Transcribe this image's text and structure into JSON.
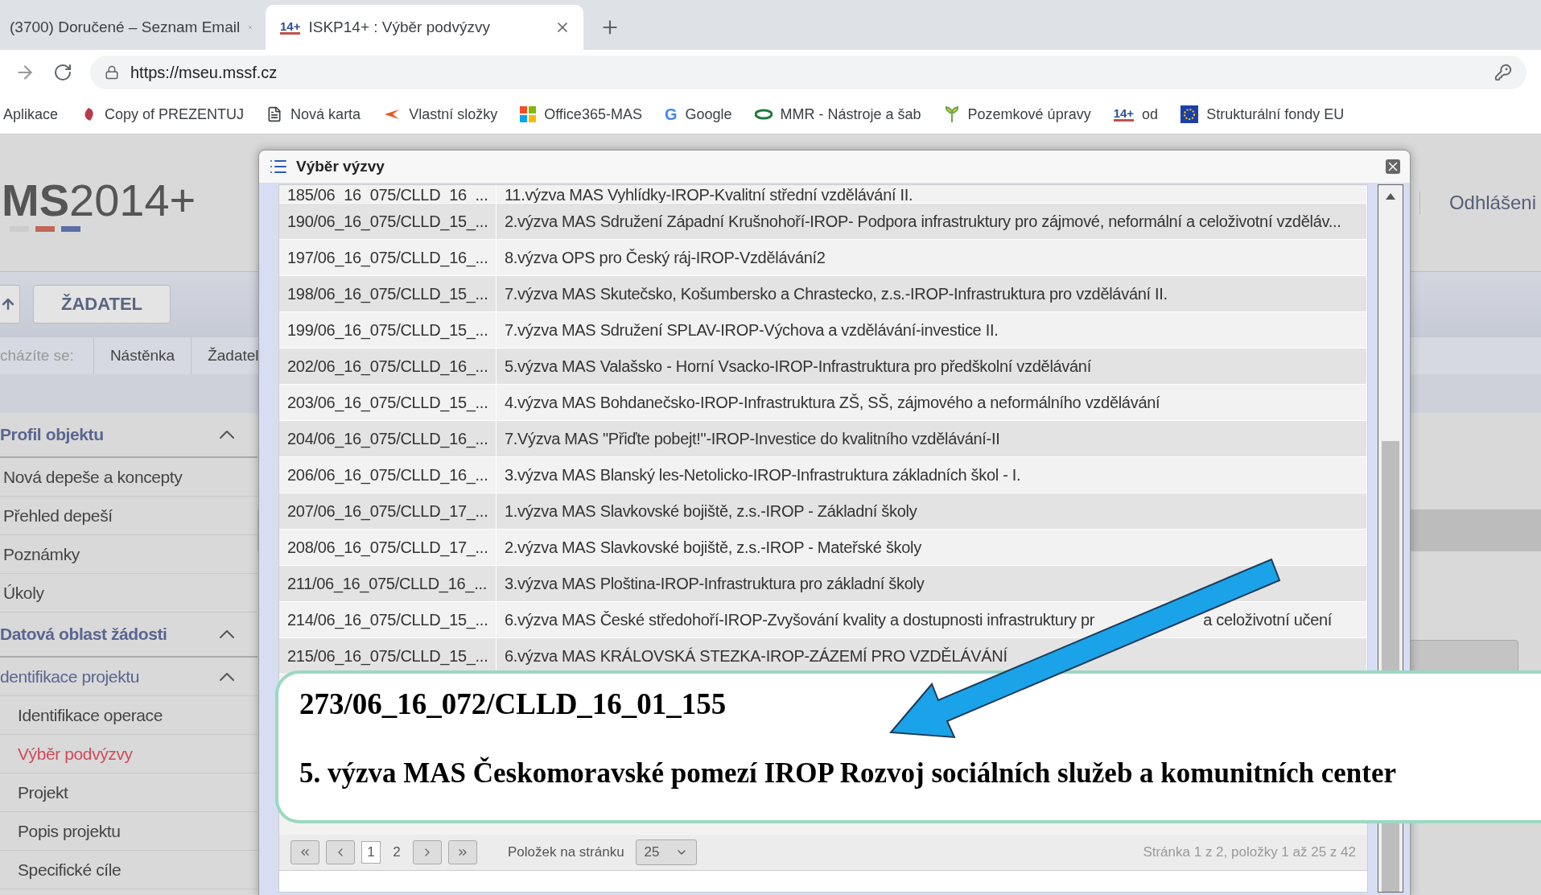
{
  "browser": {
    "tabs": [
      {
        "title": "(3700) Doručené – Seznam Email",
        "selected": false
      },
      {
        "title": "ISKP14+ : Výběr podvýzvy",
        "icon_text": "14+",
        "selected": true
      }
    ],
    "url": "https://mseu.mssf.cz",
    "bookmarks": [
      {
        "kind": "apps",
        "label": "Aplikace"
      },
      {
        "kind": "app",
        "label": "Copy of PREZENTUJ"
      },
      {
        "kind": "page",
        "label": "Nová karta"
      },
      {
        "kind": "folder",
        "label": "Vlastní složky"
      },
      {
        "kind": "windows",
        "label": "Office365-MAS"
      },
      {
        "kind": "google",
        "label": "Google",
        "icon_text": "G"
      },
      {
        "kind": "mmr",
        "label": "MMR - Nástroje a šab"
      },
      {
        "kind": "leaf",
        "label": "Pozemkové úpravy"
      },
      {
        "kind": "iskp",
        "label": "od",
        "icon_text": "14+"
      },
      {
        "kind": "eu",
        "label": "Strukturální fondy EU"
      }
    ]
  },
  "page": {
    "logo": {
      "bold": "MS",
      "light": "2014+"
    },
    "logout": "Odhlášeni",
    "role_button": "ŽADATEL",
    "breadcrumb": [
      "cházíte se:",
      "Nástěnka",
      "Žadatel"
    ],
    "sidebar": [
      {
        "kind": "section",
        "label": "Profil objektu",
        "expanded": true,
        "children": [
          {
            "kind": "item",
            "label": "Nová depeše a koncepty",
            "selected": false
          },
          {
            "kind": "item",
            "label": "Přehled depeší",
            "selected": false
          },
          {
            "kind": "item",
            "label": "Poznámky",
            "selected": false
          },
          {
            "kind": "item",
            "label": "Úkoly",
            "selected": false
          }
        ]
      },
      {
        "kind": "section",
        "label": "Datová oblast žádosti",
        "expanded": true,
        "children": [
          {
            "kind": "group",
            "label": "dentifikace projektu",
            "expanded": true,
            "children": [
              {
                "kind": "item",
                "label": "Identifikace operace",
                "selected": false
              },
              {
                "kind": "item",
                "label": "Výběr podvýzvy",
                "selected": true
              },
              {
                "kind": "item",
                "label": "Projekt",
                "selected": false
              },
              {
                "kind": "item",
                "label": "Popis projektu",
                "selected": false
              },
              {
                "kind": "item",
                "label": "Specifické cíle",
                "selected": false
              }
            ]
          }
        ]
      }
    ]
  },
  "dialog": {
    "title": "Výběr výzvy",
    "rows": [
      {
        "code": "185/06_16_075/CLLD_16_...",
        "name": [
          "11.výzva MAS Vyhlídky-IROP-Kvalitní střední vzdělávání II."
        ]
      },
      {
        "code": "190/06_16_075/CLLD_15_...",
        "name": [
          "2.výzva MAS Sdružení Západní Krušnohoří-IROP- Podpora infrastruktury pro zájmové, neformální a celoživotní vzděláv..."
        ]
      },
      {
        "code": "197/06_16_075/CLLD_16_...",
        "name": [
          "8.výzva OPS pro Český ráj-IROP-Vzdělávání2"
        ]
      },
      {
        "code": "198/06_16_075/CLLD_15_...",
        "name": [
          "7.výzva MAS Skutečsko, Košumbersko a Chrastecko, z.s.-IROP-Infrastruktura pro vzdělávání II."
        ]
      },
      {
        "code": "199/06_16_075/CLLD_15_...",
        "name": [
          "7.výzva MAS Sdružení SPLAV-IROP-Výchova a vzdělávání-investice II."
        ]
      },
      {
        "code": "202/06_16_075/CLLD_16_...",
        "name": [
          "5.výzva MAS Valašsko - Horní Vsacko-IROP-Infrastruktura pro předškolní vzdělávání"
        ]
      },
      {
        "code": "203/06_16_075/CLLD_15_...",
        "name": [
          "4.výzva MAS Bohdanečsko-IROP-Infrastruktura ZŠ, SŠ, zájmového a neformálního vzdělávání"
        ]
      },
      {
        "code": "204/06_16_075/CLLD_16_...",
        "name": [
          "7.Výzva MAS \"Přiďte pobejt!\"-IROP-Investice do kvalitního vzdělávání-II"
        ]
      },
      {
        "code": "206/06_16_075/CLLD_16_...",
        "name": [
          "3.výzva MAS Blanský les-Netolicko-IROP-Infrastruktura základních škol - I."
        ]
      },
      {
        "code": "207/06_16_075/CLLD_17_...",
        "name": [
          "1.výzva MAS Slavkovské bojiště, z.s.-IROP - Základní školy"
        ]
      },
      {
        "code": "208/06_16_075/CLLD_17_...",
        "name": [
          "2.výzva MAS Slavkovské bojiště, z.s.-IROP - Mateřské školy"
        ]
      },
      {
        "code": "211/06_16_075/CLLD_16_...",
        "name": [
          "3.výzva MAS Ploština-IROP-Infrastruktura pro základní školy"
        ]
      },
      {
        "code": "214/06_16_075/CLLD_15_...",
        "name": [
          "6.výzva MAS České středohoří-IROP-Zvyšování kvality a dostupnosti infrastruktury pr",
          "a celoživotní učení"
        ]
      },
      {
        "code": "215/06_16_075/CLLD_15_...",
        "name": [
          "6.výzva MAS KRÁLOVSKÁ STEZKA-IROP-ZÁZEMÍ PRO VZDĚLÁVÁNÍ"
        ]
      }
    ],
    "pages": [
      {
        "label": "1",
        "selected": true
      },
      {
        "label": "2",
        "selected": false
      }
    ],
    "per_page_label": "Položek na stránku",
    "per_page": "25",
    "summary": "Stránka 1 z 2, položky 1 až 25 z 42"
  },
  "callout": {
    "code": "273/06_16_072/CLLD_16_01_155",
    "text": "5. výzva MAS Českomoravské pomezí IROP Rozvoj sociálních služeb a komunitních center"
  }
}
